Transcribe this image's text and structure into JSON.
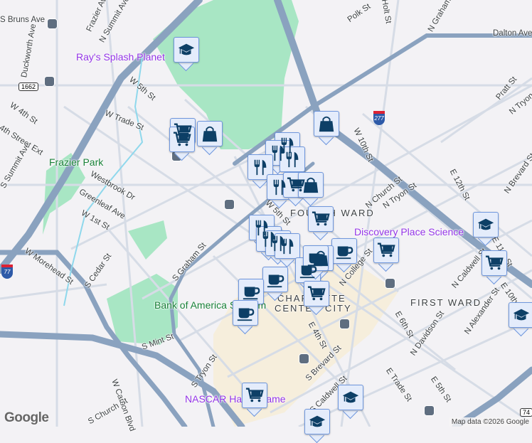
{
  "streets": [
    "S Bruns Ave",
    "Frazier Ave",
    "N Summit Ave",
    "Duckworth Ave",
    "W 5th St",
    "W Trade St",
    "W 4th St",
    "4th Street Ext",
    "S Summit Ave",
    "Westbrook Dr",
    "Greenleaf Ave",
    "W 1st St",
    "W Morehead St",
    "S Cedar St",
    "S Graham St",
    "S Mint St",
    "S Tryon St",
    "W Carson Blvd",
    "S Church St",
    "Polk St",
    "N Graham St",
    "Dalton Ave",
    "W 10th St",
    "N Church St",
    "N Tryon St",
    "E 12th St",
    "N Brevard St",
    "N Caldwell St",
    "E 11th St",
    "E 10th St",
    "N College St",
    "E 6th St",
    "E 4th St",
    "S Brevard St",
    "N Davidson St",
    "N Alexander St",
    "E Trade St",
    "E 5th St",
    "S Caldwell St",
    "W 5th St",
    "Holt St",
    "Pratt St",
    "N Tryon St"
  ],
  "pois": {
    "splash": "Ray's Splash Planet",
    "park": "Frazier Park",
    "stadium": "Bank of America Stadium",
    "discovery": "Discovery Place Science",
    "nascar": "NASCAR Hall of Fame"
  },
  "districts": {
    "fourth": "FOURTH WARD",
    "first": "FIRST WARD",
    "center1": "CHARLOTTE",
    "center2": "CENTER CITY"
  },
  "shields": {
    "route": "1662",
    "i77": "77",
    "i277": "277",
    "us74": "74"
  },
  "markers": [
    "graduation-cap",
    "shopping-cart",
    "shopping-cart",
    "shopping-bag",
    "shopping-bag",
    "restaurant",
    "restaurant",
    "restaurant",
    "restaurant",
    "restaurant",
    "shopping-cart",
    "shopping-bag",
    "shopping-cart",
    "restaurant",
    "restaurant",
    "restaurant",
    "restaurant",
    "coffee",
    "shopping-bag",
    "coffee",
    "coffee",
    "coffee",
    "coffee",
    "coffee",
    "shopping-cart",
    "shopping-cart",
    "graduation-cap",
    "shopping-cart",
    "graduation-cap",
    "shopping-cart",
    "graduation-cap",
    "graduation-cap"
  ],
  "google_logo": "Google",
  "attribution": "Map data ©2026 Google",
  "colors": {
    "highway": "#8aa2bf",
    "park": "#a8e6c4",
    "downtown": "#f6eedc",
    "marker_icon": "#0d3f66"
  }
}
